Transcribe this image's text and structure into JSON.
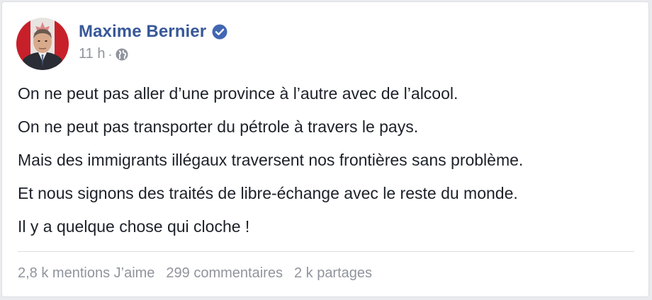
{
  "post": {
    "author": "Maxime Bernier",
    "verified": true,
    "timestamp": "11 h",
    "separator": "·",
    "privacy_icon": "globe-icon",
    "lines": [
      "On ne peut pas aller d’une province à l’autre avec de l’alcool.",
      "On ne peut pas transporter du pétrole à travers le pays.",
      "Mais des immigrants illégaux traversent nos frontières sans problème.",
      "Et nous signons des traités de libre-échange avec le reste du monde.",
      "Il y a quelque chose qui cloche !"
    ]
  },
  "stats": {
    "likes": "2,8 k mentions J’aime",
    "comments": "299 commentaires",
    "shares": "2 k partages"
  },
  "colors": {
    "name": "#385898",
    "verified_badge": "#4267b2",
    "text": "#1d2129",
    "muted": "#90949c",
    "divider": "#dadde1"
  }
}
